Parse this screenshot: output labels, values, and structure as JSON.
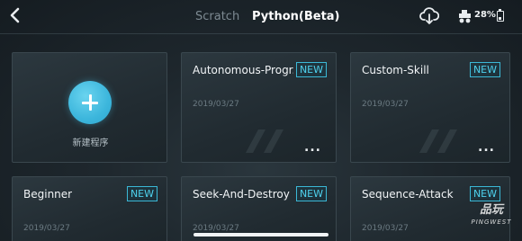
{
  "header": {
    "back_label": "<",
    "tabs": [
      {
        "label": "Scratch",
        "active": false
      },
      {
        "label": "Python(Beta)",
        "active": true
      }
    ],
    "battery_percent": "28%",
    "icons": [
      "chevron-left-icon",
      "cloud-download-icon",
      "robot-icon",
      "battery-icon"
    ]
  },
  "new_program": {
    "label": "新建程序",
    "icon": "plus-icon"
  },
  "projects": [
    {
      "title": "Autonomous-Progr...",
      "badge": "NEW",
      "date": "2019/03/27",
      "menu": "..."
    },
    {
      "title": "Custom-Skill",
      "badge": "NEW",
      "date": "2019/03/27",
      "menu": "..."
    },
    {
      "title": "Beginner",
      "badge": "NEW",
      "date": "2019/03/27"
    },
    {
      "title": "Seek-And-Destroy",
      "badge": "NEW",
      "date": "2019/03/27"
    },
    {
      "title": "Sequence-Attack",
      "badge": "NEW",
      "date": "2019/03/27"
    }
  ],
  "watermark": {
    "main": "品玩",
    "sub": "PINGWEST"
  },
  "colors": {
    "background": "#1c252b",
    "accent": "#3cb6dc",
    "badge": "#4fd2ee",
    "muted": "#6b7a82"
  }
}
